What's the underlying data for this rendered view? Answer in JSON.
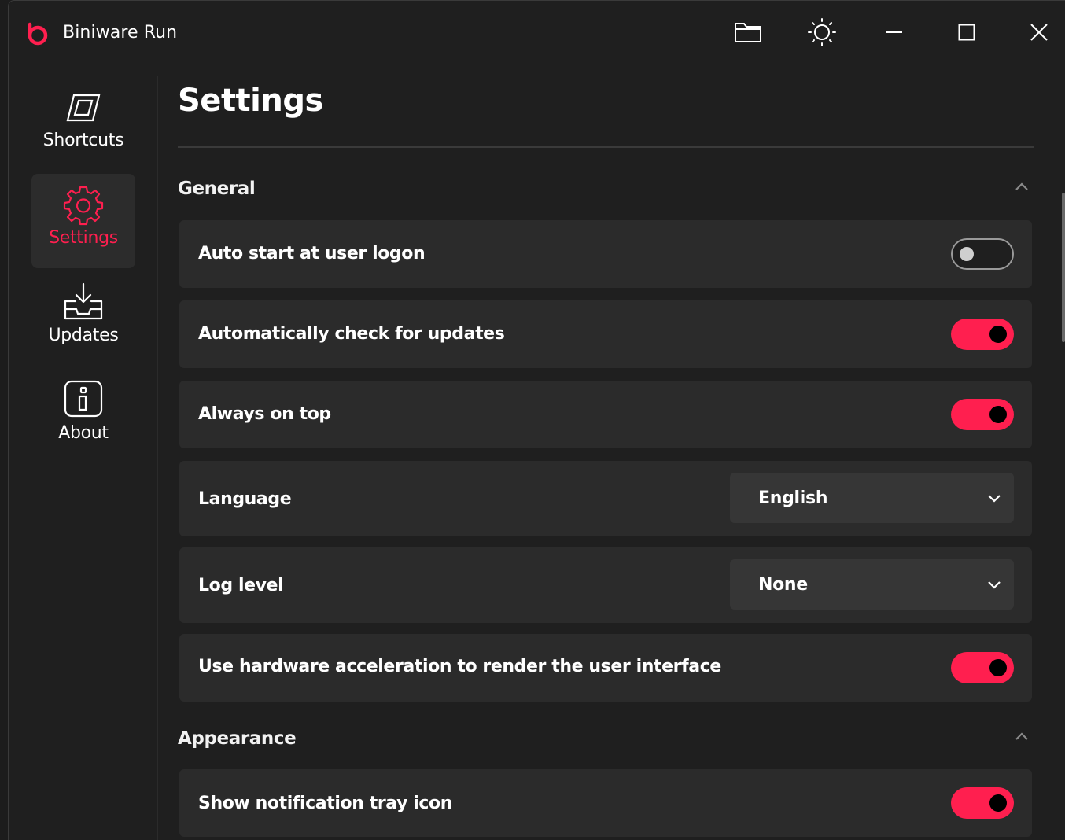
{
  "app": {
    "title": "Biniware Run",
    "accent": "#ff1f4f"
  },
  "titlebar": {
    "icons": [
      "folder-icon",
      "theme-sun-icon",
      "minimize-icon",
      "maximize-icon",
      "close-icon"
    ]
  },
  "sidebar": {
    "items": [
      {
        "label": "Shortcuts",
        "icon": "shortcuts-icon",
        "active": false
      },
      {
        "label": "Settings",
        "icon": "gear-icon",
        "active": true
      },
      {
        "label": "Updates",
        "icon": "download-icon",
        "active": false
      },
      {
        "label": "About",
        "icon": "info-icon",
        "active": false
      }
    ]
  },
  "main": {
    "title": "Settings",
    "sections": [
      {
        "title": "General",
        "expanded": true,
        "settings": [
          {
            "label": "Auto start at user logon",
            "type": "toggle",
            "on": false
          },
          {
            "label": "Automatically check for updates",
            "type": "toggle",
            "on": true
          },
          {
            "label": "Always on top",
            "type": "toggle",
            "on": true
          },
          {
            "label": "Language",
            "type": "select",
            "value": "English"
          },
          {
            "label": "Log level",
            "type": "select",
            "value": "None"
          },
          {
            "label": "Use hardware acceleration to render the user interface",
            "type": "toggle",
            "on": true
          }
        ]
      },
      {
        "title": "Appearance",
        "expanded": true,
        "settings": [
          {
            "label": "Show notification tray icon",
            "type": "toggle",
            "on": true
          }
        ]
      }
    ]
  }
}
